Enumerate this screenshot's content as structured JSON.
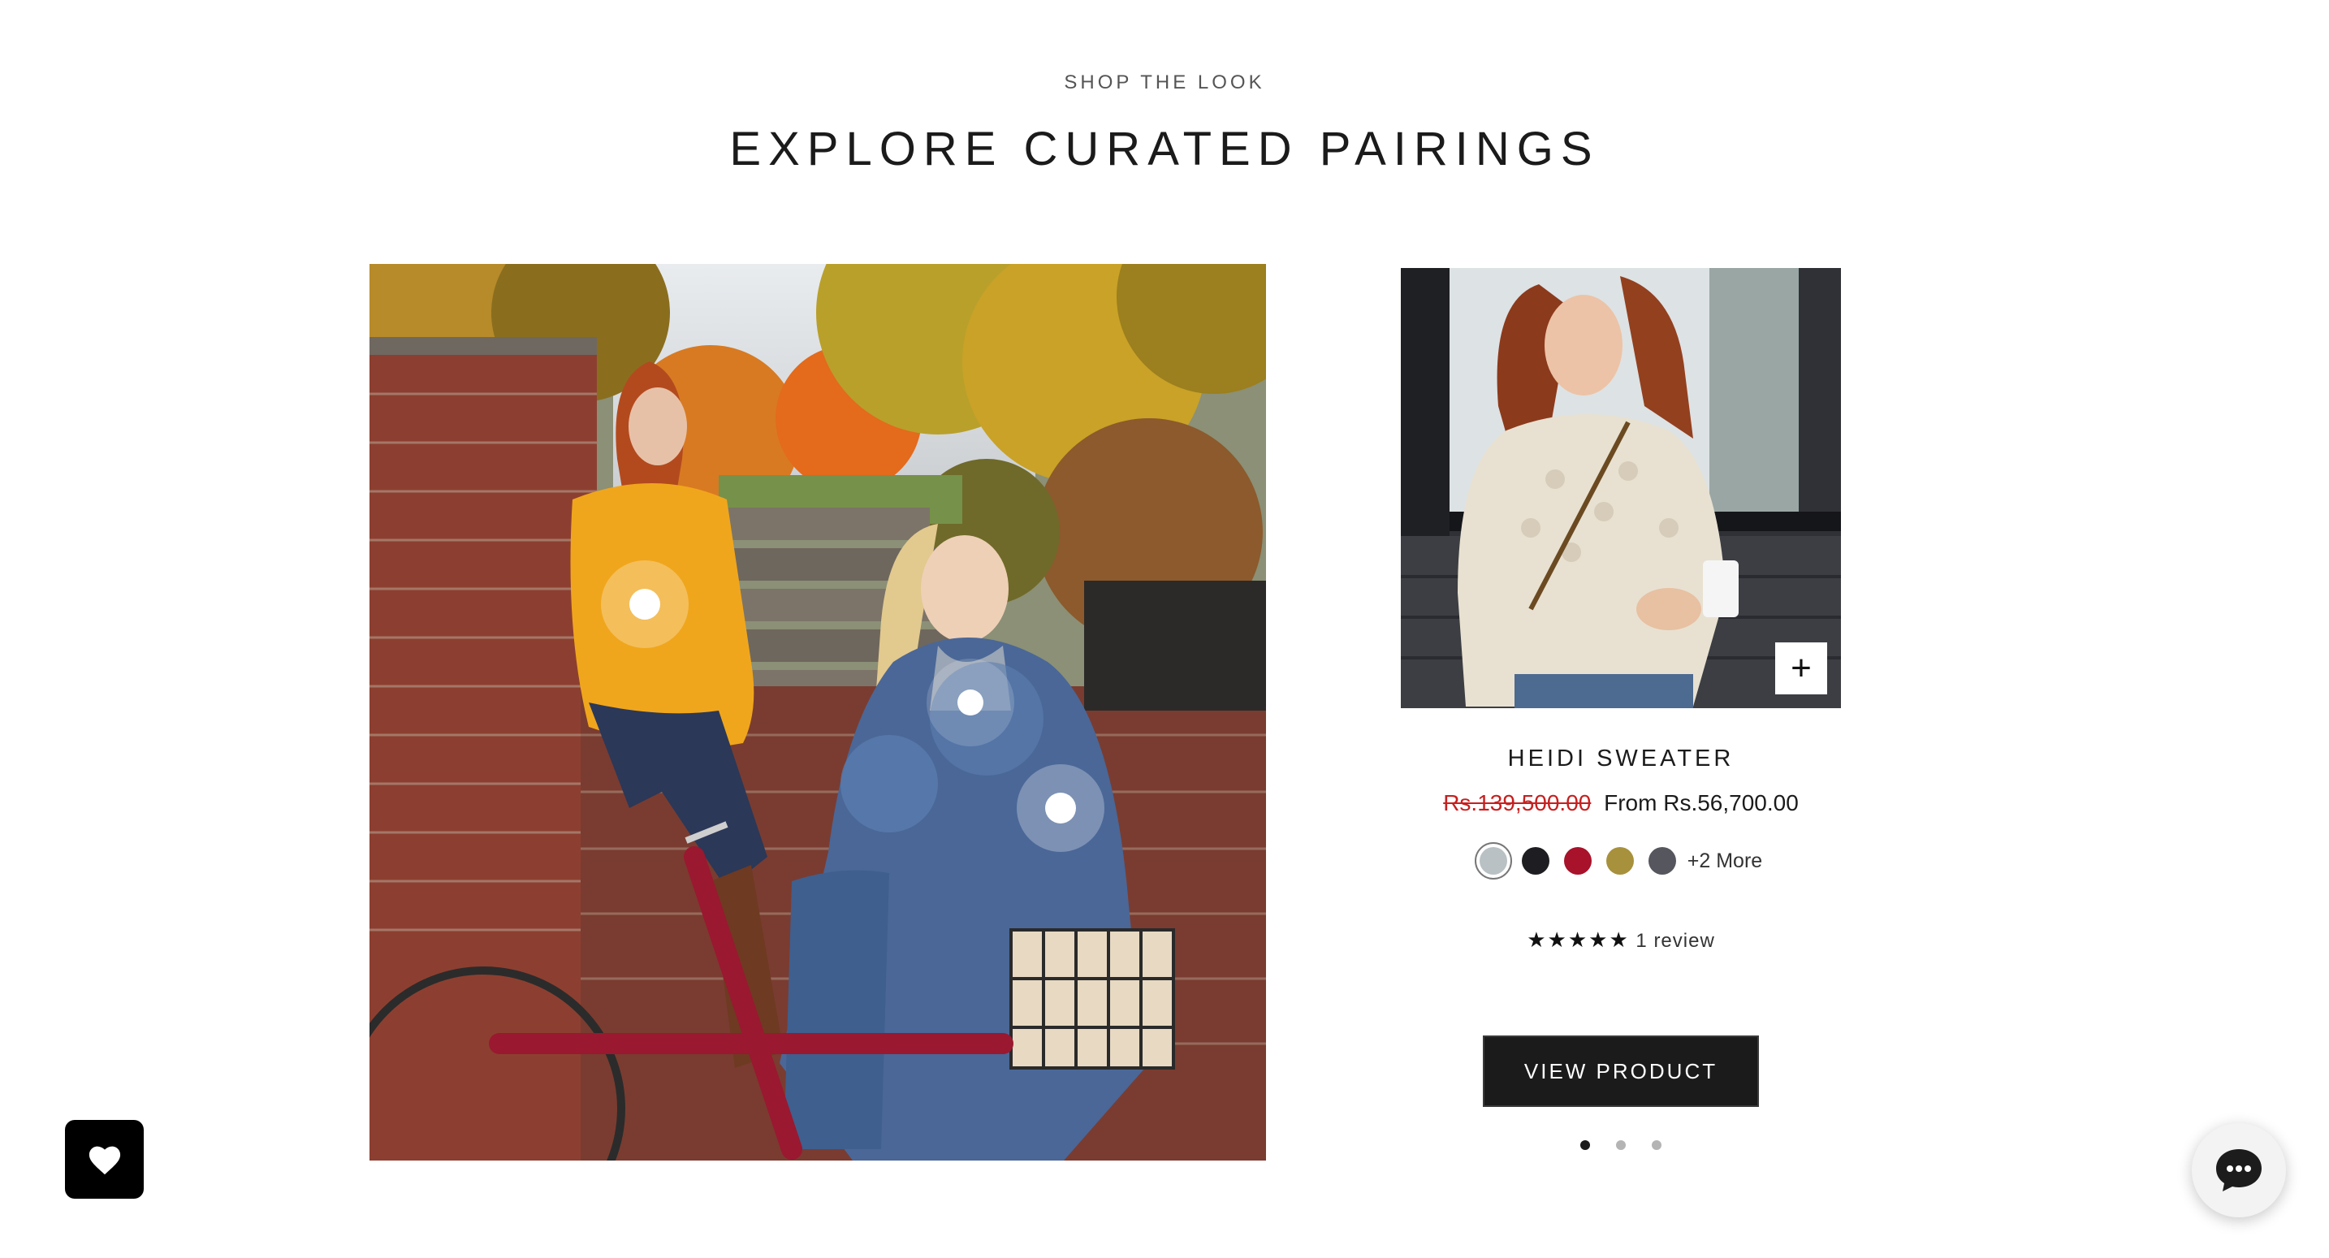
{
  "section": {
    "eyebrow": "SHOP THE LOOK",
    "heading": "EXPLORE CURATED PAIRINGS"
  },
  "scene": {
    "hotspots": [
      {
        "product": "yellow-sweater",
        "active": true
      },
      {
        "product": "grey-top",
        "active": false
      },
      {
        "product": "blue-wrap",
        "active": true
      }
    ]
  },
  "product": {
    "title": "HEIDI SWEATER",
    "compare_price": "Rs.139,500.00",
    "price": "From Rs.56,700.00",
    "swatches": [
      {
        "name": "grey",
        "color": "#b9c1c4",
        "selected": true
      },
      {
        "name": "black",
        "color": "#1e1e22",
        "selected": false
      },
      {
        "name": "red",
        "color": "#a8122a",
        "selected": false
      },
      {
        "name": "gold",
        "color": "#a8913c",
        "selected": false
      },
      {
        "name": "charcoal",
        "color": "#55565e",
        "selected": false
      }
    ],
    "more_swatches": "+2 More",
    "stars": "★★★★★",
    "rating_value": 5,
    "reviews": "1 review",
    "button": "VIEW PRODUCT",
    "quick_add_icon": "plus-icon"
  },
  "carousel": {
    "count": 3,
    "active": 1
  },
  "floating": {
    "wishlist_icon": "heart-icon",
    "chat_icon": "chat-bubble-icon"
  },
  "colors": {
    "accent": "#1b1b1b",
    "sale": "#c62020",
    "sweater_yellow": "#f0a820",
    "wrap_blue": "#4d6d9c"
  }
}
